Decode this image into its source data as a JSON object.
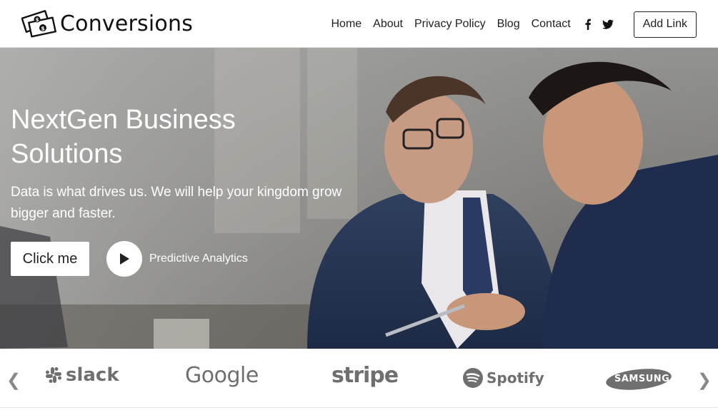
{
  "header": {
    "brand_name": "Conversions",
    "nav": [
      "Home",
      "About",
      "Privacy Policy",
      "Blog",
      "Contact"
    ],
    "social_icons": [
      "facebook-icon",
      "twitter-icon"
    ],
    "add_link_label": "Add Link"
  },
  "hero": {
    "title": "NextGen Business Solutions",
    "subtitle": "Data is what drives us. We will help your kingdom grow bigger and faster.",
    "cta_label": "Click me",
    "play_label": "Predictive Analytics"
  },
  "logos": {
    "items": [
      "slack",
      "Google",
      "stripe",
      "Spotify",
      "SAMSUNG"
    ],
    "prev_icon": "chevron-left-icon",
    "next_icon": "chevron-right-icon"
  },
  "colors": {
    "logo_gray": "#6f6f6f",
    "hero_text": "#ffffff",
    "border": "#e3e3e3"
  }
}
